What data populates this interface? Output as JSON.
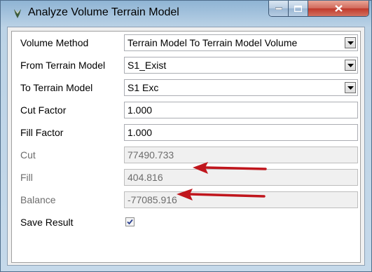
{
  "window": {
    "title": "Analyze Volume Terrain Model"
  },
  "form": {
    "volume_method": {
      "label": "Volume Method",
      "value": "Terrain Model To Terrain Model Volume"
    },
    "from_terrain_model": {
      "label": "From Terrain Model",
      "value": "S1_Exist"
    },
    "to_terrain_model": {
      "label": "To Terrain Model",
      "value": "S1 Exc"
    },
    "cut_factor": {
      "label": "Cut Factor",
      "value": "1.000"
    },
    "fill_factor": {
      "label": "Fill Factor",
      "value": "1.000"
    },
    "cut": {
      "label": "Cut",
      "value": "77490.733"
    },
    "fill": {
      "label": "Fill",
      "value": "404.816"
    },
    "balance": {
      "label": "Balance",
      "value": "-77085.916"
    },
    "save_result": {
      "label": "Save Result",
      "checked": true
    }
  },
  "colors": {
    "arrow": "#c0161d",
    "close_button": "#c0392b"
  }
}
